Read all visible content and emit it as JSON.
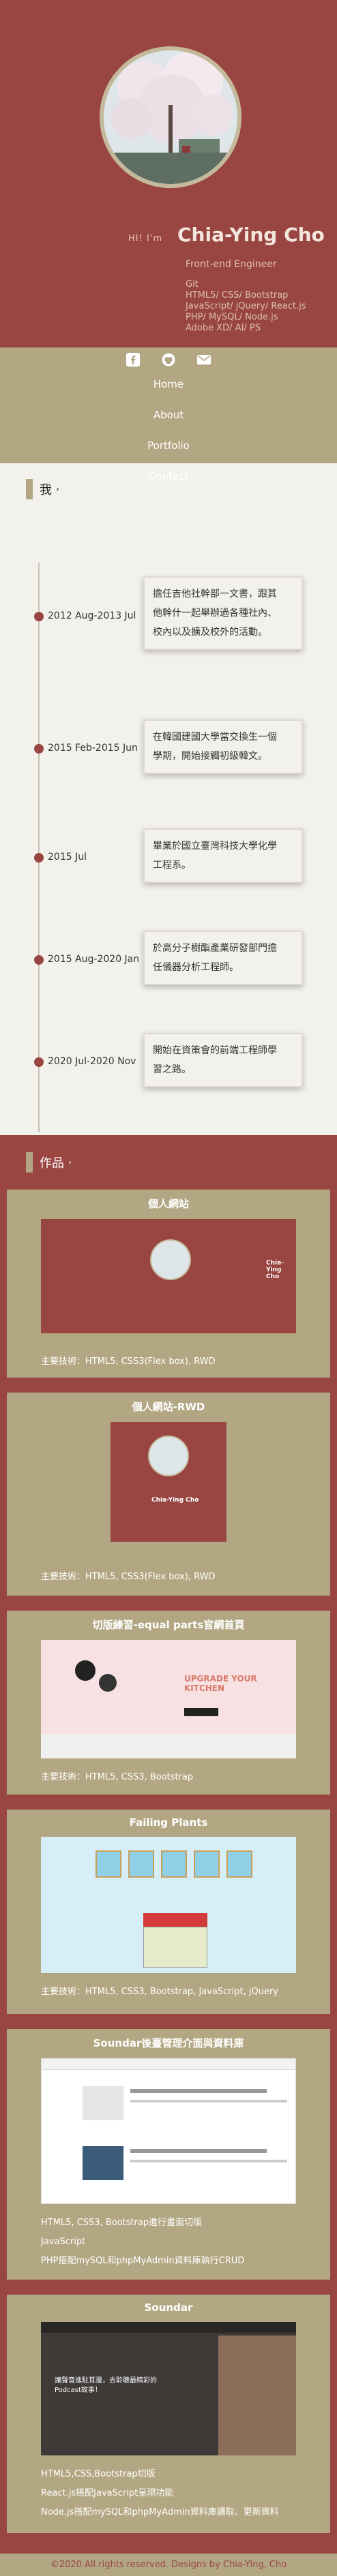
{
  "hero": {
    "greeting": "HI! I'm",
    "name": "Chia-Ying Cho",
    "role": "Front-end Engineer",
    "skills": [
      "Git",
      "HTML5/ CSS/ Bootstrap",
      "JavaScript/ jQuery/ React.js",
      "PHP/ MySQL/ Node.js",
      "Adobe XD/ AI/ PS"
    ]
  },
  "nav": {
    "icons": [
      "facebook-icon",
      "github-icon",
      "mail-icon"
    ],
    "links": [
      "Home",
      "About",
      "Portfolio",
      "Contact"
    ]
  },
  "about": {
    "title": "我",
    "items": [
      {
        "date": "2012 Aug-2013 Jul",
        "lines": [
          "擔任吉他社幹部一文書，跟其",
          "他幹什一起舉辦過各種社內、",
          "校內以及擴及校外的活動。"
        ]
      },
      {
        "date": "2015 Feb-2015 Jun",
        "lines": [
          "在韓國建國大學當交換生一個",
          "學期，開始接觸初級韓文。"
        ]
      },
      {
        "date": "2015 Jul",
        "lines": [
          "畢業於國立臺灣科技大學化學",
          "工程系。"
        ]
      },
      {
        "date": "2015 Aug-2020 Jan",
        "lines": [
          "於高分子樹酯產業研發部門擔",
          "任儀器分析工程師。"
        ]
      },
      {
        "date": "2020 Jul-2020 Nov",
        "lines": [
          "開始在資策會的前端工程師學",
          "習之路。"
        ]
      }
    ]
  },
  "works": {
    "title": "作品",
    "items": [
      {
        "title": "個人網站",
        "tech": [
          "主要技術：HTML5, CSS3(Flex box), RWD"
        ],
        "thumb_name": "Chia-Ying Cho"
      },
      {
        "title": "個人網站-RWD",
        "tech": [
          "主要技術：HTML5, CSS3(Flex box), RWD"
        ],
        "thumb_name": "Chia-Ying Cho"
      },
      {
        "title": "切版練習-equal parts官網首頁",
        "tech": [
          "主要技術：HTML5, CSS3, Bootstrap"
        ],
        "thumb_heading": "UPGRADE YOUR KITCHEN"
      },
      {
        "title": "Failing Plants",
        "tech": [
          "主要技術：HTML5, CSS3, Bootstrap, JavaScript, jQuery"
        ]
      },
      {
        "title": "Soundar後臺管理介面與資料庫",
        "tech": [
          "HTML5, CSS3, Bootstrap進行畫面切版",
          "JavaScript",
          "PHP搭配mySQL和phpMyAdmin資料庫執行CRUD"
        ]
      },
      {
        "title": "Soundar",
        "tech": [
          "HTML5,CSS,Bootstrap切版",
          "React.js搭配JavaScript呈現功能",
          "Node.js搭配mySQL和phpMyAdmin資料庫讀取、更新資料"
        ],
        "thumb_heading": "讓聲音進駐耳邊，去聆聽最精彩的Podcast故事！"
      }
    ]
  },
  "footer": {
    "text": "©2020 All rights reserved. Designs by Chia-Ying, Cho"
  },
  "colors": {
    "primary": "#994542",
    "secondary": "#b3a783",
    "background": "#f3f1ec"
  }
}
